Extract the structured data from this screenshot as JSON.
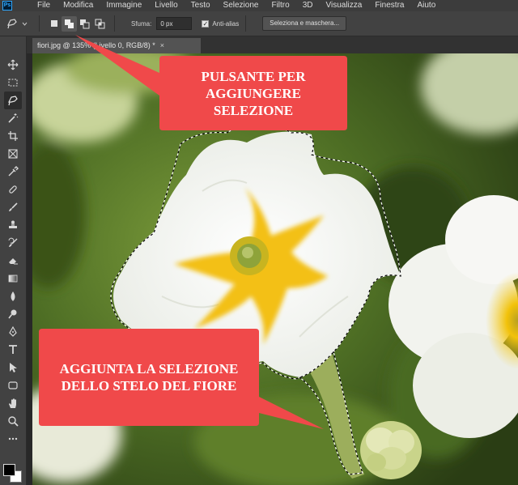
{
  "app": {
    "logo_text": "Ps",
    "accent_color": "#31a8ff"
  },
  "menu": {
    "items": [
      "File",
      "Modifica",
      "Immagine",
      "Livello",
      "Testo",
      "Selezione",
      "Filtro",
      "3D",
      "Visualizza",
      "Finestra",
      "Aiuto"
    ]
  },
  "options_bar": {
    "feather_label": "Sfuma:",
    "feather_value": "0 px",
    "antialias_label": "Anti-alias",
    "antialias_checked": true,
    "select_mask_label": "Seleziona e maschera...",
    "selection_modes": [
      "new-selection",
      "add-to-selection",
      "subtract-from-selection",
      "intersect-with-selection"
    ],
    "active_mode": "add-to-selection"
  },
  "toolbar": {
    "tools": [
      "move-icon",
      "marquee-icon",
      "lasso-icon",
      "magic-wand-icon",
      "crop-icon",
      "frame-icon",
      "eyedropper-icon",
      "spot-healing-icon",
      "brush-icon",
      "clone-stamp-icon",
      "history-brush-icon",
      "eraser-icon",
      "gradient-icon",
      "blur-icon",
      "dodge-icon",
      "pen-icon",
      "type-icon",
      "path-selection-icon",
      "rectangle-icon",
      "hand-icon",
      "zoom-icon",
      "more-icon"
    ],
    "active_tool": "lasso-icon",
    "foreground_color": "#000000",
    "background_color": "#ffffff"
  },
  "document": {
    "tab_title": "fiori.jpg @ 135% (Livello 0, RGB/8) *",
    "close_symbol": "×"
  },
  "annotations": {
    "callout_color": "#f0494a",
    "top": "PULSANTE PER AGGIUNGERE SELEZIONE",
    "bottom": "AGGIUNTA LA SELEZIONE DELLO STELO DEL FIORE"
  }
}
